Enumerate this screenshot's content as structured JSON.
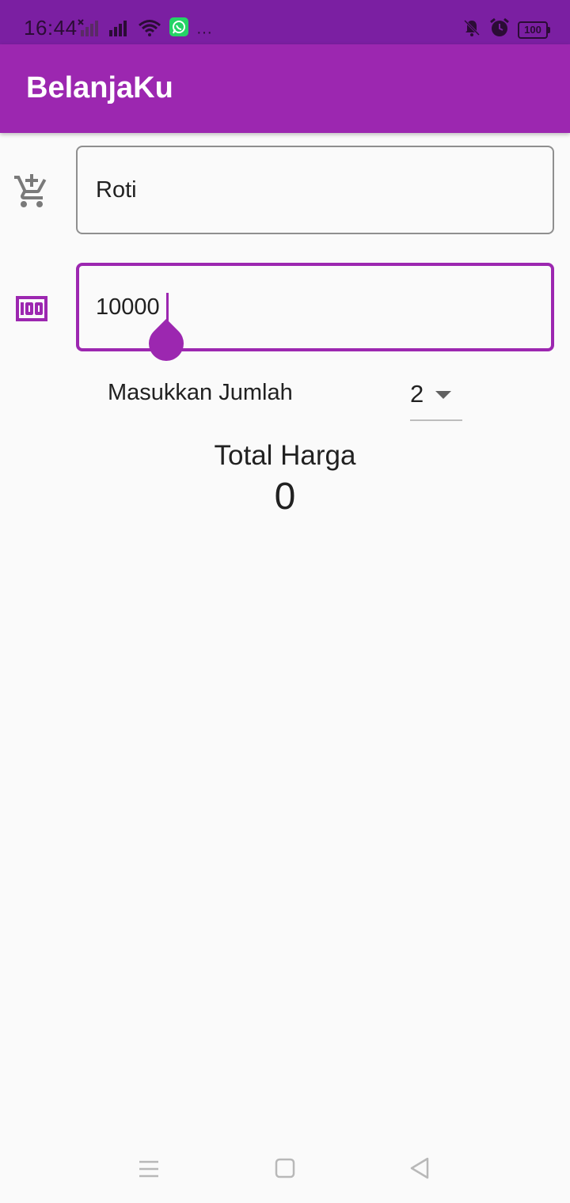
{
  "status_bar": {
    "time": "16:44",
    "battery": "100",
    "icons": [
      "no-sim-signal-icon",
      "signal-icon",
      "wifi-icon",
      "whatsapp-icon",
      "more-dots-icon",
      "notifications-off-icon",
      "alarm-icon",
      "battery-icon"
    ],
    "more": "···"
  },
  "app_bar": {
    "title": "BelanjaKu"
  },
  "form": {
    "item_field": {
      "icon": "add-shopping-cart-icon",
      "value": "Roti"
    },
    "price_field": {
      "icon": "money-icon",
      "value": "10000"
    },
    "quantity": {
      "label": "Masukkan Jumlah",
      "selected": "2"
    }
  },
  "total": {
    "label": "Total Harga",
    "value": "0"
  },
  "nav_bar": {
    "icons": [
      "menu-icon",
      "home-icon",
      "back-icon"
    ]
  },
  "colors": {
    "primary": "#9c27b0",
    "primary_dark": "#7b1fa2",
    "background": "#fafafa",
    "whatsapp": "#25d366"
  }
}
